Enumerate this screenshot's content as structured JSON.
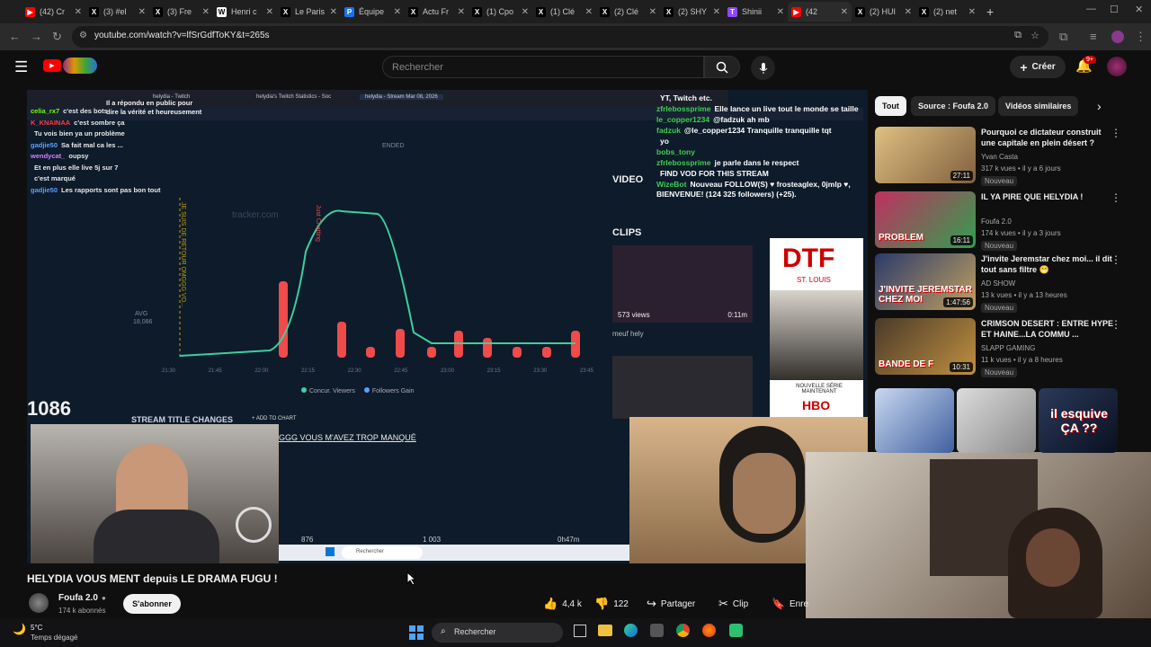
{
  "browser": {
    "tabs": [
      {
        "title": "(42) Cr",
        "icon": "youtube-icon",
        "color": "#ff0000",
        "glyph": "▶"
      },
      {
        "title": "(3) #el",
        "icon": "x-icon",
        "color": "#000000",
        "glyph": "X"
      },
      {
        "title": "(3) Fre",
        "icon": "x-icon",
        "color": "#000000",
        "glyph": "X"
      },
      {
        "title": "Henri c",
        "icon": "wikipedia-icon",
        "color": "#ffffff",
        "glyph": "W"
      },
      {
        "title": "Le Paris",
        "icon": "x-icon",
        "color": "#000000",
        "glyph": "X"
      },
      {
        "title": "Équipe",
        "icon": "p-icon",
        "color": "#1a73e8",
        "glyph": "P"
      },
      {
        "title": "Actu Fr",
        "icon": "x-icon",
        "color": "#000000",
        "glyph": "X"
      },
      {
        "title": "(1) Cpo",
        "icon": "x-icon",
        "color": "#000000",
        "glyph": "X"
      },
      {
        "title": "(1) Clé",
        "icon": "x-icon",
        "color": "#000000",
        "glyph": "X"
      },
      {
        "title": "(2) Clé",
        "icon": "x-icon",
        "color": "#000000",
        "glyph": "X"
      },
      {
        "title": "(2) SHY",
        "icon": "x-icon",
        "color": "#000000",
        "glyph": "X"
      },
      {
        "title": "Shinii",
        "icon": "twitch-icon",
        "color": "#9146ff",
        "glyph": "T"
      },
      {
        "title": "(42",
        "icon": "youtube-icon",
        "color": "#ff0000",
        "glyph": "▶"
      },
      {
        "title": "(2) HUI",
        "icon": "x-icon",
        "color": "#000000",
        "glyph": "X"
      },
      {
        "title": "(2) net",
        "icon": "x-icon",
        "color": "#000000",
        "glyph": "X"
      }
    ],
    "url": "youtube.com/watch?v=lfSrGdfToKY&t=265s"
  },
  "header": {
    "search_placeholder": "Rechercher",
    "create_label": "Créer",
    "notif_count": "9+"
  },
  "video": {
    "chat": [
      {
        "user": "celia_rx7",
        "msg": "c'est des bots",
        "color": "#7cfc00"
      },
      {
        "user": "K_KNAINAA",
        "msg": "c'est sombre ça",
        "color": "#ff4040"
      },
      {
        "user": "",
        "msg": "Tu vois bien ya un problème",
        "color": "#ff4040"
      },
      {
        "user": "gadjie50",
        "msg": "Sa fait mal ca les ...",
        "color": "#5aa0ff"
      },
      {
        "user": "wendycat_",
        "msg": "oupsy",
        "color": "#d080ff"
      },
      {
        "user": "",
        "msg": "Et en plus elle live 5j sur 7",
        "color": "#5aa0ff"
      },
      {
        "user": "",
        "msg": "c'est marqué",
        "color": "#ffffff"
      },
      {
        "user": "gadjie50",
        "msg": "Les rapports sont pas bon tout",
        "color": "#5aa0ff"
      }
    ],
    "overlay_top_msgs": [
      "Il a répondu en public pour dire la vérité et heureusement"
    ],
    "right_chat": [
      {
        "user": "",
        "msg": "YT, Twitch etc."
      },
      {
        "user": "zfrlebossprime",
        "msg": "Elle lance un live tout le monde se taille"
      },
      {
        "user": "le_copper1234",
        "msg": "@fadzuk ah mb"
      },
      {
        "user": "fadzuk",
        "msg": "@le_copper1234 Tranquille tranquille tqt"
      },
      {
        "user": "",
        "msg": "yo"
      },
      {
        "user": "bobs_tony",
        "msg": ""
      },
      {
        "user": "zfrlebossprime",
        "msg": "je parle dans le respect"
      },
      {
        "user": "",
        "msg": "FIND VOD FOR THIS STREAM"
      },
      {
        "user": "WizeBot",
        "msg": "Nouveau FOLLOW(S) ♥ frosteaglex, 0jmlp ♥, BIENVENUE! (124 325 followers) (+25)."
      }
    ],
    "chart": {
      "ended_label": "ENDED",
      "avg_label": "AVG",
      "avg_value": "18,086",
      "times": [
        "21:30",
        "21:45",
        "22:00",
        "22:15",
        "22:30",
        "22:45",
        "23:00",
        "23:15",
        "23:30",
        "23:45"
      ],
      "legend": [
        "Concur. Viewers",
        "Followers Gain"
      ],
      "annot1": "JE SUIS DE RETOUR OMGGG VO...",
      "annot2": "Just Chatting",
      "watermark": "tracker.com"
    },
    "section_video": "VIDEO",
    "section_clips": "CLIPS",
    "clip1_views": "573 views",
    "clip1_dur": "0:11m",
    "clip1_caption": "meuf hely",
    "ad_title": "DTF",
    "ad_sub": "ST. LOUIS",
    "ad_new": "NOUVELLE SÉRIE MAINTENANT",
    "ad_brand": "HBO",
    "big_number": "1086",
    "stream_title_changes": "STREAM TITLE CHANGES",
    "add_to_chart": "+ ADD TO CHART",
    "title_change": "GGG VOUS M'AVEZ TROP MANQUÉ",
    "bottom_nums": [
      "876",
      "1 003",
      "0h47m"
    ],
    "inner_search": "Rechercher",
    "inner_tabs": [
      "helydia - Twitch",
      "helydia's Twitch Statistics - Soc",
      "helydia - Stream Mar 08, 2026"
    ]
  },
  "chips": [
    {
      "label": "Tout",
      "active": true
    },
    {
      "label": "Source : Foufa 2.0",
      "active": false
    },
    {
      "label": "Vidéos similaires",
      "active": false
    }
  ],
  "recs": [
    {
      "title": "Pourquoi ce dictateur construit une capitale en plein désert ?",
      "channel": "Yvan Casta",
      "meta": "317 k vues • il y a 6 jours",
      "duration": "27:11",
      "badge": "Nouveau",
      "thumb_text": ""
    },
    {
      "title": "IL YA PIRE QUE HELYDIA !",
      "channel": "Foufa 2.0",
      "meta": "174 k vues • il y a 3 jours",
      "duration": "16:11",
      "badge": "Nouveau",
      "thumb_text": "PROBLEM"
    },
    {
      "title": "J'invite Jeremstar chez moi... il dit tout sans filtre 😁",
      "channel": "AD SHOW",
      "meta": "13 k vues • il y a 13 heures",
      "duration": "1:47:56",
      "badge": "Nouveau",
      "thumb_text": "J'INVITE JEREMSTAR CHEZ MOI"
    },
    {
      "title": "CRIMSON DESERT : ENTRE HYPE ET HAINE...LA COMMU ...",
      "channel": "SLAPP GAMING",
      "meta": "11 k vues • il y a 8 heures",
      "duration": "10:31",
      "badge": "Nouveau",
      "thumb_text": "BANDE DE F"
    }
  ],
  "shorts_thumb_text": "il esquive ÇA ??",
  "main": {
    "title": "HELYDIA VOUS MENT depuis LE DRAMA FUGU !",
    "channel": "Foufa 2.0",
    "subs": "174 k abonnés",
    "subscribe": "S'abonner",
    "likes": "4,4 k",
    "dislikes": "122",
    "share": "Partager",
    "clip": "Clip",
    "save": "Enre"
  },
  "taskbar": {
    "temp": "5°C",
    "weather": "Temps dégagé",
    "search": "Rechercher"
  },
  "colors": {
    "accent_red": "#ff0000",
    "chart_line": "#3ecf9f",
    "chart_bar": "#f04a4a",
    "chart_bg": "#0d1b2a"
  }
}
